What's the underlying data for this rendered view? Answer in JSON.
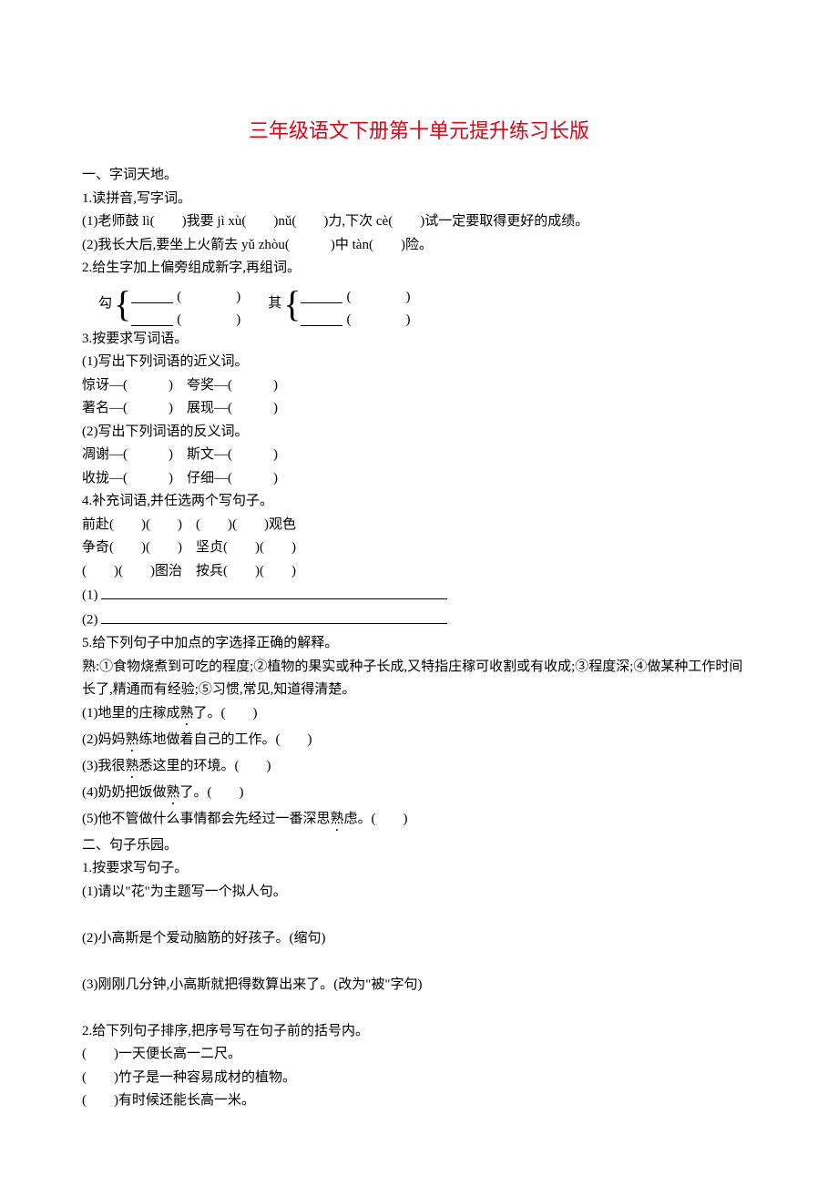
{
  "title": "三年级语文下册第十单元提升练习长版",
  "s1": {
    "h": "一、字词天地。",
    "q1": {
      "t": "1.读拼音,写字词。",
      "a": "(1)老师鼓 lì(　　)我要 jì xù(　　)nǔ(　　)力,下次 cè(　　)试一定要取得更好的成绩。",
      "b": "(2)我长大后,要坐上火箭去 yǔ zhòu(　　　)中 tàn(　　)险。"
    },
    "q2": {
      "t": "2.给生字加上偏旁组成新字,再组词。",
      "char1": "勾",
      "char2": "其"
    },
    "q3": {
      "t": "3.按要求写词语。",
      "a": "(1)写出下列词语的近义词。",
      "a1": "惊讶—(　　　)　夸奖—(　　　)",
      "a2": "著名—(　　　)　展现—(　　　)",
      "b": "(2)写出下列词语的反义词。",
      "b1": "凋谢—(　　　)　斯文—(　　　)",
      "b2": "收拢—(　　　)　仔细—(　　　)"
    },
    "q4": {
      "t": "4.补充词语,并任选两个写句子。",
      "l1": "前赴(　　)(　　)　(　　)(　　)观色",
      "l2": "争奇(　　)(　　)　坚贞(　　)(　　)",
      "l3": "(　　)(　　)图治　按兵(　　)(　　)",
      "p1": "(1)",
      "p2": "(2)"
    },
    "q5": {
      "t": "5.给下列句子中加点的字选择正确的解释。",
      "def": "熟:①食物烧煮到可吃的程度;②植物的果实或种子长成,又特指庄稼可收割或有收成;③程度深;④做某种工作时间长了,精通而有经验;⑤习惯,常见,知道得清楚。",
      "a_pre": "(1)地里的庄稼成",
      "a_dot": "熟",
      "a_post": "了。(　　)",
      "b_pre": "(2)妈妈",
      "b_dot": "熟",
      "b_post": "练地做着自己的工作。(　　)",
      "c_pre": "(3)我很",
      "c_dot": "熟",
      "c_post": "悉这里的环境。(　　)",
      "d_pre": "(4)奶奶把饭做",
      "d_dot": "熟",
      "d_post": "了。(　　)",
      "e_pre": "(5)他不管做什么事情都会先经过一番深思",
      "e_dot": "熟",
      "e_post": "虑。(　　)"
    }
  },
  "s2": {
    "h": "二、句子乐园。",
    "q1": {
      "t": "1.按要求写句子。",
      "a": "(1)请以\"花\"为主题写一个拟人句。",
      "b": "(2)小高斯是个爱动脑筋的好孩子。(缩句)",
      "c": "(3)刚刚几分钟,小高斯就把得数算出来了。(改为\"被\"字句)"
    },
    "q2": {
      "t": "2.给下列句子排序,把序号写在句子前的括号内。",
      "a": "(　　)一天便长高一二尺。",
      "b": "(　　)竹子是一种容易成材的植物。",
      "c": "(　　)有时候还能长高一米。"
    }
  }
}
